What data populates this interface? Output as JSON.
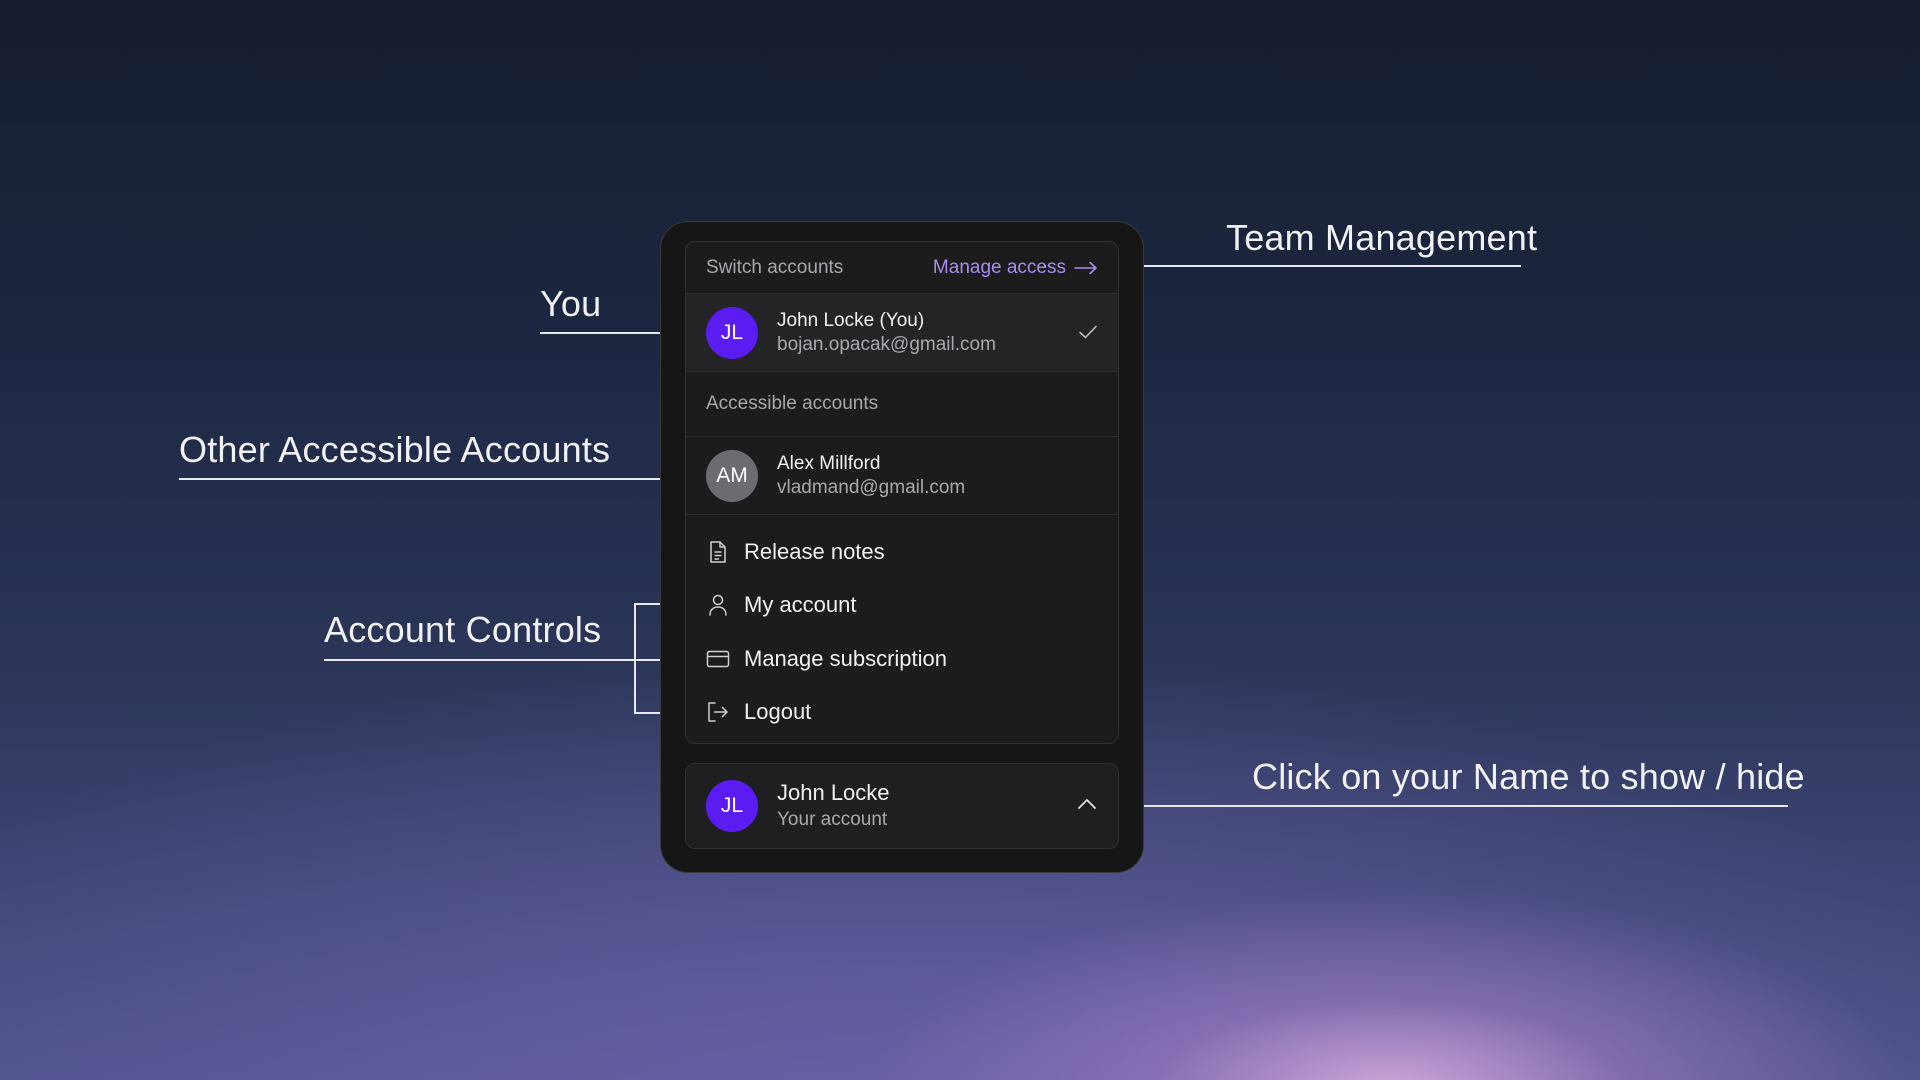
{
  "annotations": {
    "you": "You",
    "other_accounts": "Other Accessible Accounts",
    "account_controls": "Account Controls",
    "team_management": "Team Management",
    "click_name": "Click on your Name to show / hide"
  },
  "menu": {
    "header_title": "Switch accounts",
    "manage_access": "Manage access",
    "current_account": {
      "initials": "JL",
      "name": "John Locke (You)",
      "email": "bojan.opacak@gmail.com",
      "selected": true
    },
    "accessible_label": "Accessible accounts",
    "accessible_accounts": [
      {
        "initials": "AM",
        "name": "Alex Millford",
        "email": "vladmand@gmail.com"
      }
    ],
    "items": [
      {
        "label": "Release notes",
        "icon": "document-icon"
      },
      {
        "label": "My account",
        "icon": "user-icon"
      },
      {
        "label": "Manage subscription",
        "icon": "credit-card-icon"
      },
      {
        "label": "Logout",
        "icon": "logout-icon"
      }
    ]
  },
  "footer": {
    "initials": "JL",
    "name": "John Locke",
    "subtitle": "Your account"
  },
  "colors": {
    "accent_purple": "#5b1cf2",
    "link_purple": "#a98bf2",
    "panel_bg": "#161616"
  }
}
